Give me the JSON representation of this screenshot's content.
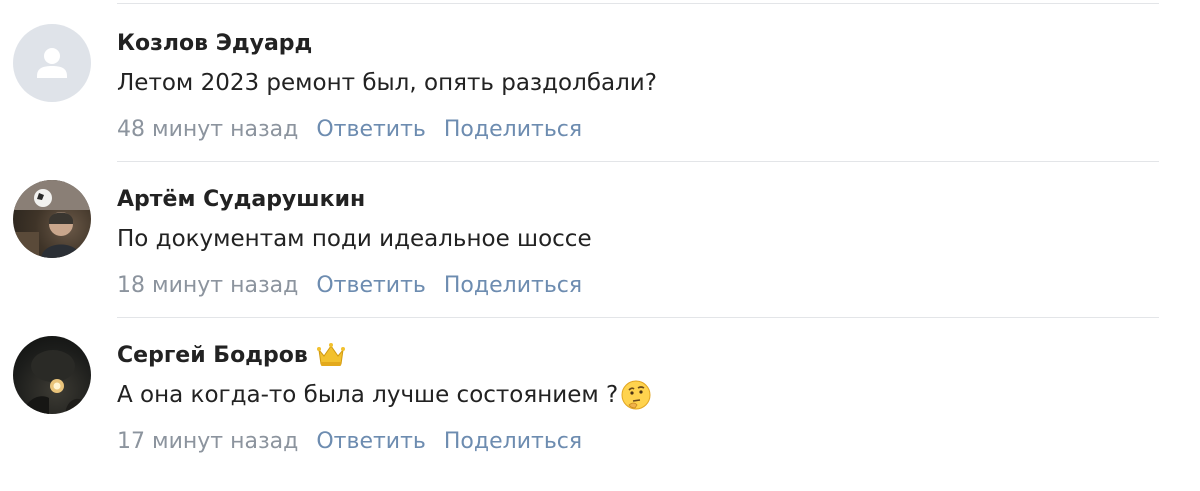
{
  "comments": [
    {
      "author": "Козлов Эдуард",
      "text": "Летом 2023 ремонт был, опять раздолбали?",
      "time": "48 минут назад",
      "reply_label": "Ответить",
      "share_label": "Поделиться"
    },
    {
      "author": "Артём Сударушкин",
      "text": "По документам поди идеальное шоссе",
      "time": "18 минут назад",
      "reply_label": "Ответить",
      "share_label": "Поделиться"
    },
    {
      "author": "Сергей Бодров",
      "text": "А она когда-то была лучше состоянием ?",
      "time": "17 минут назад",
      "reply_label": "Ответить",
      "share_label": "Поделиться",
      "badge_icon": "crown-icon",
      "emoji_icon": "thinking-face-icon"
    }
  ],
  "colors": {
    "author": "#222222",
    "time": "#8c949e",
    "action_link": "#6d8cb0",
    "divider": "#e3e5e8",
    "avatar_placeholder": "#dfe3e9"
  }
}
